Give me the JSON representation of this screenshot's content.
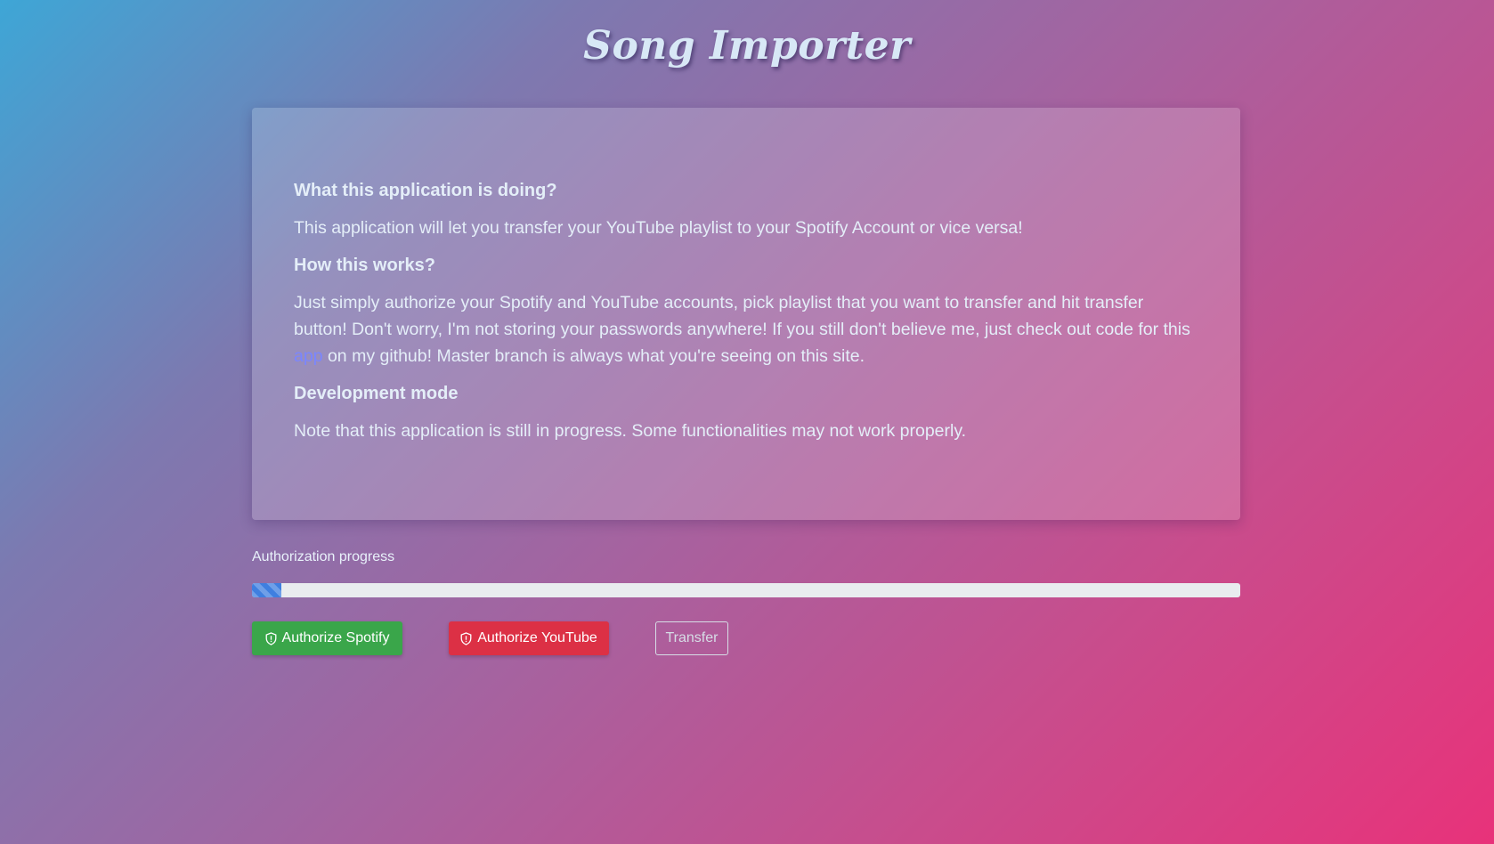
{
  "app": {
    "title": "Song Importer"
  },
  "info": {
    "heading_what": "What this application is doing?",
    "text_what": "This application will let you transfer your YouTube playlist to your Spotify Account or vice versa!",
    "heading_how": "How this works?",
    "text_how_before_link": "Just simply authorize your Spotify and YouTube accounts, pick playlist that you want to transfer and hit transfer button! Don't worry, I'm not storing your passwords anywhere! If you still don't believe me, just check out code for this ",
    "link_label": "app",
    "text_how_after_link": " on my github! Master branch is always what you're seeing on this site.",
    "heading_dev": "Development mode",
    "text_dev": "Note that this application is still in progress. Some functionalities may not work properly."
  },
  "progress": {
    "label": "Authorization progress",
    "percent": 3
  },
  "buttons": {
    "spotify_label": "Authorize Spotify",
    "youtube_label": "Authorize YouTube",
    "transfer_label": "Transfer",
    "spotify_icon": "shield-icon",
    "youtube_icon": "shield-icon"
  },
  "colors": {
    "spotify": "#3aa64a",
    "youtube": "#dc3045",
    "progress": "#3f7fe0",
    "link": "#7a86ff"
  }
}
